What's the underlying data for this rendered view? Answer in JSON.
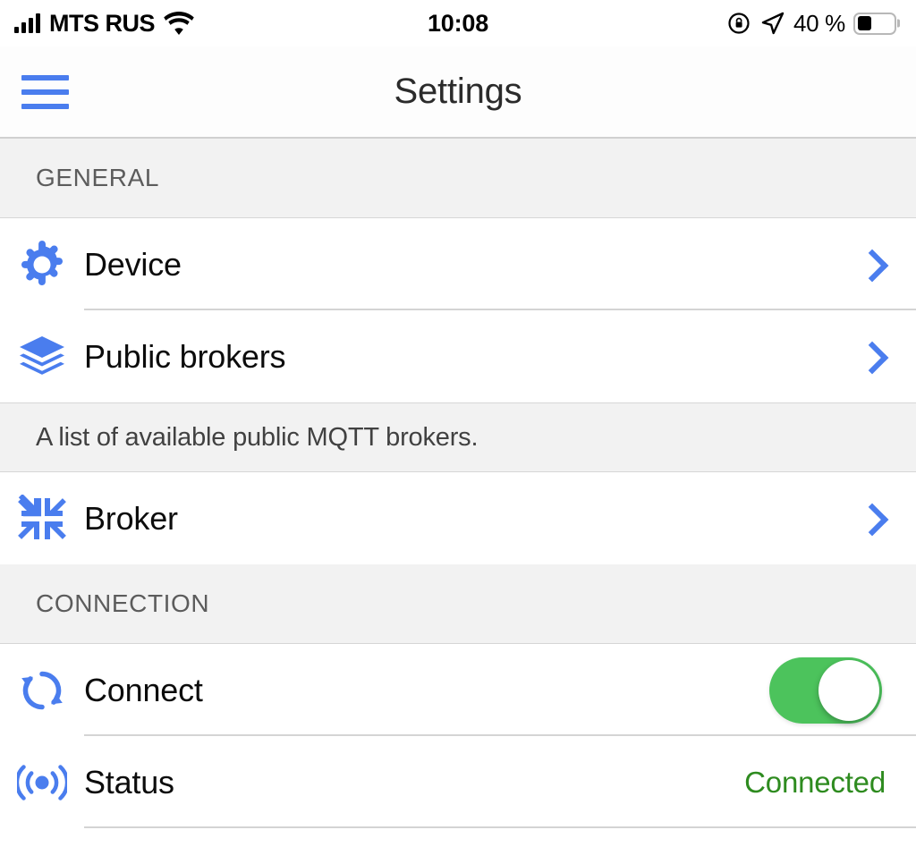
{
  "status_bar": {
    "carrier": "MTS RUS",
    "signal_icon": "cellular-signal-icon",
    "wifi_icon": "wifi-icon",
    "time": "10:08",
    "rotation_lock_icon": "rotation-lock-icon",
    "location_icon": "location-arrow-icon",
    "battery_percent": "40 %",
    "battery_level": 40,
    "battery_icon": "battery-icon"
  },
  "nav": {
    "menu_icon": "hamburger-menu-icon",
    "title": "Settings"
  },
  "sections": [
    {
      "header": "GENERAL",
      "rows": [
        {
          "icon": "gear-icon",
          "label": "Device",
          "accessory": "chevron"
        },
        {
          "icon": "layers-icon",
          "label": "Public brokers",
          "accessory": "chevron"
        }
      ],
      "footer": "A list of available public MQTT brokers."
    },
    {
      "header": "",
      "rows": [
        {
          "icon": "compress-arrows-icon",
          "label": "Broker",
          "accessory": "chevron"
        }
      ],
      "footer": ""
    },
    {
      "header": "CONNECTION",
      "rows": [
        {
          "icon": "sync-icon",
          "label": "Connect",
          "accessory": "toggle",
          "toggle_on": true
        },
        {
          "icon": "broadcast-icon",
          "label": "Status",
          "accessory": "value",
          "value": "Connected"
        }
      ],
      "footer": ""
    }
  ],
  "colors": {
    "accent_blue": "#4a7dee",
    "toggle_on_green": "#4cc35c",
    "status_connected_green": "#2e8b1f",
    "section_bg": "#f2f2f2",
    "separator": "#d4d4d4"
  }
}
